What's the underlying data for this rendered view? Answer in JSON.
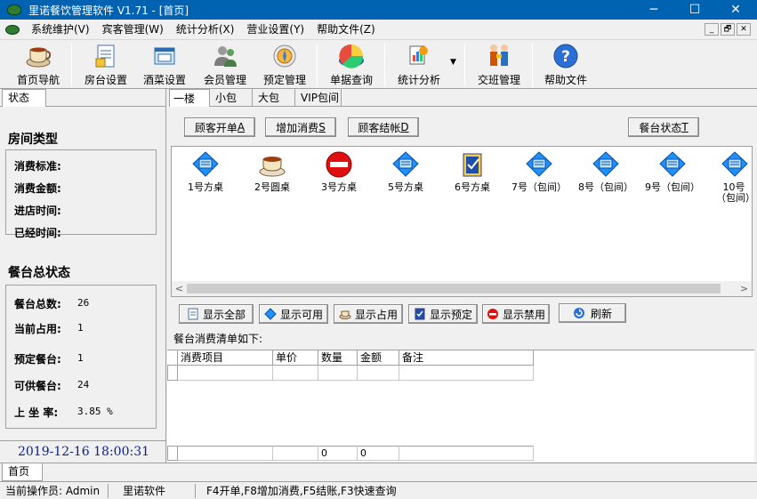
{
  "window": {
    "title": "里诺餐饮管理软件 V1.71 - [首页]",
    "minimize": "─",
    "maximize": "☐",
    "close": "✕"
  },
  "menu": {
    "items": [
      "系统维护(V)",
      "宾客管理(W)",
      "统计分析(X)",
      "营业设置(Y)",
      "帮助文件(Z)"
    ],
    "mdi": [
      "_",
      "🗗",
      "✕"
    ]
  },
  "toolbar": {
    "buttons": [
      "首页导航",
      "房台设置",
      "酒菜设置",
      "会员管理",
      "预定管理",
      "单据查询",
      "统计分析",
      "交班管理",
      "帮助文件"
    ],
    "dropdown_arrow": "▼"
  },
  "left": {
    "tab": "状态",
    "room_type_title": "房间类型",
    "room_fields": [
      "消费标准:",
      "消费金额:",
      "进店时间:",
      "已经时间:"
    ],
    "status_title": "餐台总状态",
    "status_fields": [
      {
        "label": "餐台总数:",
        "value": "26"
      },
      {
        "label": "当前占用:",
        "value": "1"
      },
      {
        "label": "预定餐台:",
        "value": "1"
      },
      {
        "label": "可供餐台:",
        "value": "24"
      },
      {
        "label": "上 坐 率:",
        "value": "3.85 %"
      }
    ],
    "datetime": "2019-12-16  18:00:31"
  },
  "floors": {
    "tabs": [
      "一楼",
      "小包",
      "大包",
      "VIP包间"
    ],
    "active": 0
  },
  "actions": {
    "open_table": {
      "text": "顾客开单",
      "key": "A"
    },
    "add_consume": {
      "text": "增加消费",
      "key": "S"
    },
    "checkout": {
      "text": "顾客结帐",
      "key": "D"
    },
    "table_status": {
      "text": "餐台状态",
      "key": "T"
    }
  },
  "tables": [
    {
      "name": "1号方桌",
      "icon": "card-icon"
    },
    {
      "name": "2号圆桌",
      "icon": "teacup-icon"
    },
    {
      "name": "3号方桌",
      "icon": "forbidden-icon"
    },
    {
      "name": "5号方桌",
      "icon": "card-icon"
    },
    {
      "name": "6号方桌",
      "icon": "reserved-icon"
    },
    {
      "name": "7号（包间）",
      "icon": "card-icon"
    },
    {
      "name": "8号（包间）",
      "icon": "card-icon"
    },
    {
      "name": "9号（包间）",
      "icon": "card-icon"
    },
    {
      "name": "10号（包间）",
      "icon": "card-icon"
    }
  ],
  "scroll": {
    "left": "<",
    "right": ">"
  },
  "filters": [
    "显示全部",
    "显示可用",
    "显示占用",
    "显示预定",
    "显示禁用",
    "刷新"
  ],
  "consume_label": "餐台消费清单如下:",
  "grid": {
    "headers": [
      "消费项目",
      "单价",
      "数量",
      "金额",
      "备注"
    ],
    "totals": {
      "qty": "0",
      "amount": "0"
    }
  },
  "bottom_tab": "首页",
  "statusbar": {
    "operator": "当前操作员: Admin",
    "company": "里诺软件",
    "hints": "F4开单,F8增加消费,F5结账,F3快速查询"
  },
  "colors": {
    "titlebar": "#0063b1",
    "datetime": "#0a1f8f",
    "card_blue": "#1e90ff",
    "forbidden_red": "#e01010"
  }
}
